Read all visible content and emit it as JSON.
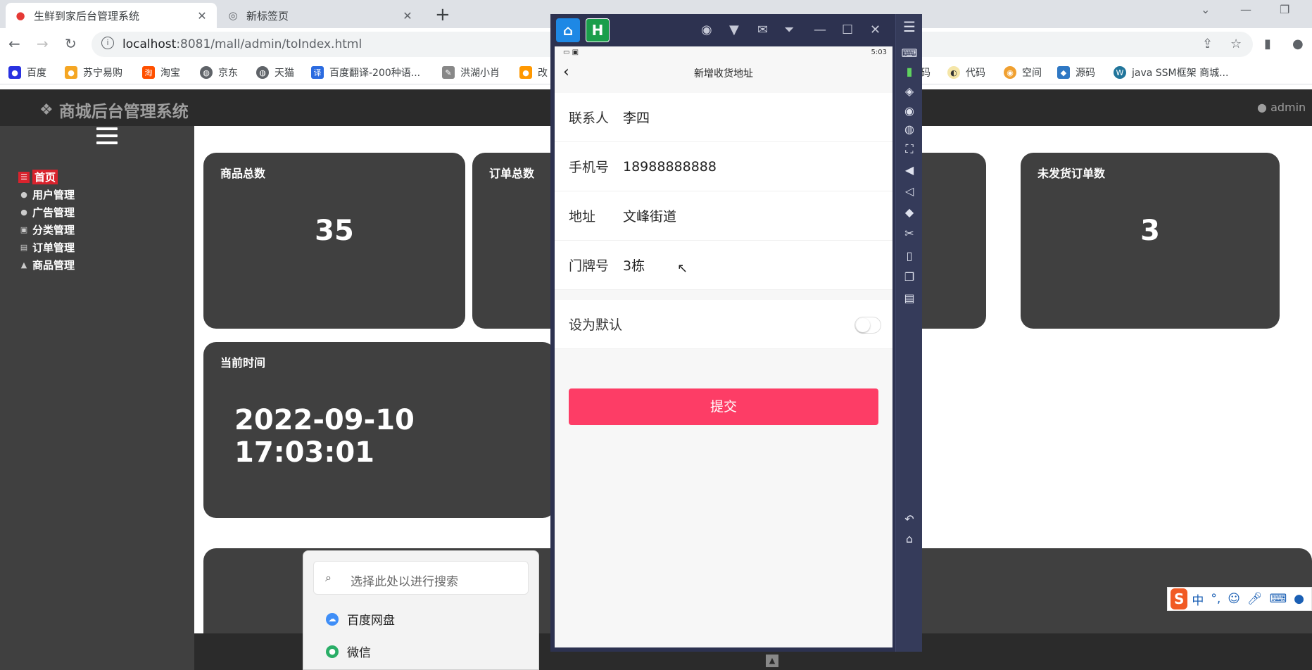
{
  "browser": {
    "tabs": [
      {
        "title": "生鲜到家后台管理系统",
        "active": true
      },
      {
        "title": "新标签页",
        "active": false
      }
    ],
    "url_host": "localhost",
    "url_path": ":8081/mall/admin/toIndex.html",
    "bookmarks": [
      "百度",
      "苏宁易购",
      "淘宝",
      "京东",
      "天猫",
      "百度翻译-200种语...",
      "洪湖小肖",
      "改",
      "码",
      "代码",
      "空间",
      "源码",
      "java SSM框架 商城..."
    ]
  },
  "admin": {
    "logo": "商城后台管理系统",
    "user": "admin",
    "menu": [
      "首页",
      "用户管理",
      "广告管理",
      "分类管理",
      "订单管理",
      "商品管理"
    ],
    "cards": {
      "products_title": "商品总数",
      "products_value": "35",
      "orders_title": "订单总数",
      "unshipped_title": "未发货订单数",
      "unshipped_value": "3",
      "time_title": "当前时间",
      "time_value": "2022-09-10 17:03:01"
    }
  },
  "winsearch": {
    "placeholder": "选择此处以进行搜索",
    "items": [
      "百度网盘",
      "微信"
    ]
  },
  "phone": {
    "time": "5:03",
    "title": "新增收货地址",
    "fields": [
      {
        "label": "联系人",
        "value": "李四"
      },
      {
        "label": "手机号",
        "value": "18988888888"
      },
      {
        "label": "地址",
        "value": "文峰街道"
      },
      {
        "label": "门牌号",
        "value": "3栋"
      }
    ],
    "default_label": "设为默认",
    "default_on": false,
    "submit": "提交"
  },
  "ime": {
    "mode": "中",
    "punct": "°,"
  },
  "colors": {
    "accent_red": "#d9232d",
    "submit_pink": "#fd3d66",
    "card_bg": "#404040"
  }
}
